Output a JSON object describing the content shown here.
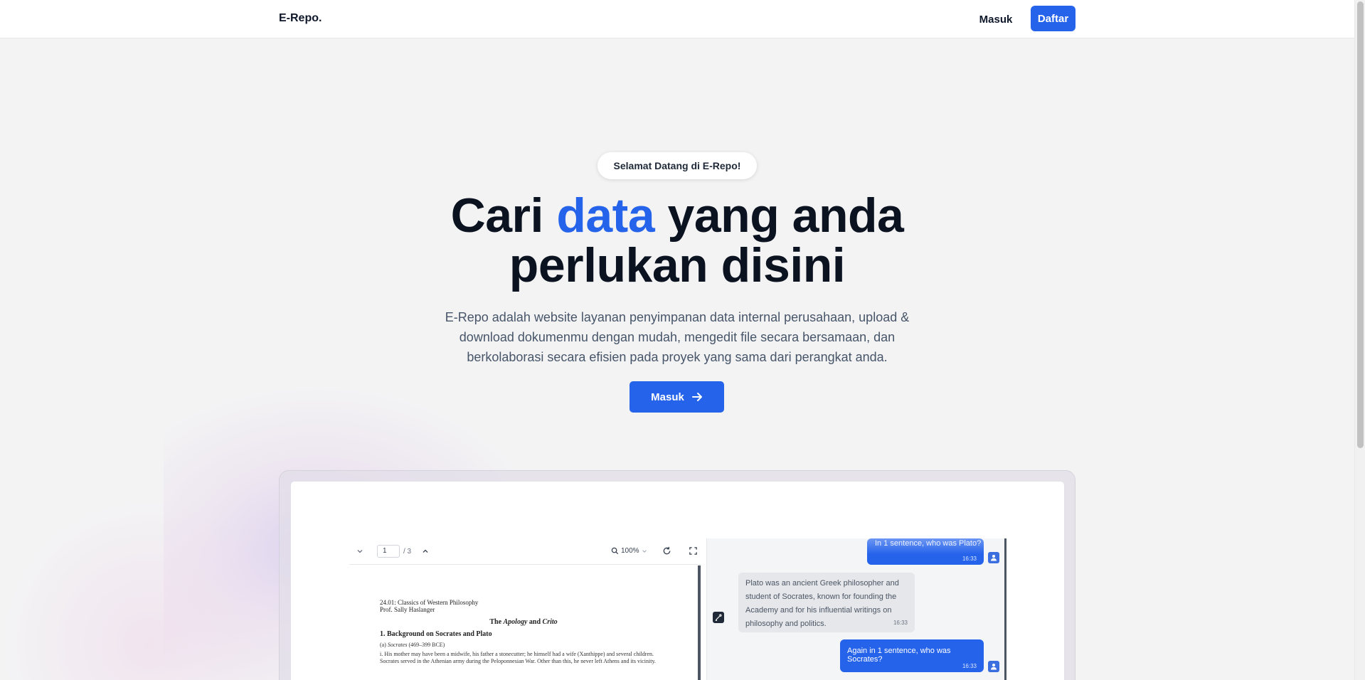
{
  "navbar": {
    "brand": "E-Repo.",
    "login_label": "Masuk",
    "register_label": "Daftar"
  },
  "hero": {
    "badge": "Selamat Datang di E-Repo!",
    "headline_part1": "Cari ",
    "headline_accent": "data",
    "headline_part2": " yang anda",
    "headline_line2": "perlukan disini",
    "description": "E-Repo adalah website layanan penyimpanan data internal perusahaan, upload & download dokumenmu dengan mudah, mengedit file secara bersamaan, dan berkolaborasi secara efisien pada proyek yang sama dari perangkat anda.",
    "cta_label": "Masuk"
  },
  "preview": {
    "pdf": {
      "page_current": "1",
      "page_total": "/ 3",
      "zoom": "100%",
      "course_line1": "24.01: Classics of Western Philosophy",
      "course_line2": "Prof. Sally Haslanger",
      "title_the": "The ",
      "title_apology": "Apology",
      "title_and": " and ",
      "title_crito": "Crito",
      "heading": "1.  Background on Socrates and Plato",
      "subheading_a": "(a) ",
      "subheading_name": "Socrates",
      "subheading_dates": " (469–399 BCE)",
      "body": "i. His mother may have been a midwife, his father a stonecutter; he himself had a wife (Xanthippe) and several children. Socrates served in the Athenian army during the Peloponnesian War. Other than this, he never left Athens and its vicinity."
    },
    "chat": {
      "msg1": "In 1 sentence, who was Plato?",
      "msg1_time": "16:33",
      "reply1": "Plato was an ancient Greek philosopher and student of Socrates, known for founding the Academy and for his influential writings on philosophy and politics.",
      "reply1_time": "16:33",
      "msg2": "Again in 1 sentence, who was Socrates?",
      "msg2_time": "16:33"
    }
  },
  "colors": {
    "accent": "#2563eb",
    "background": "#f3f3f4",
    "headline": "#0b1220"
  }
}
